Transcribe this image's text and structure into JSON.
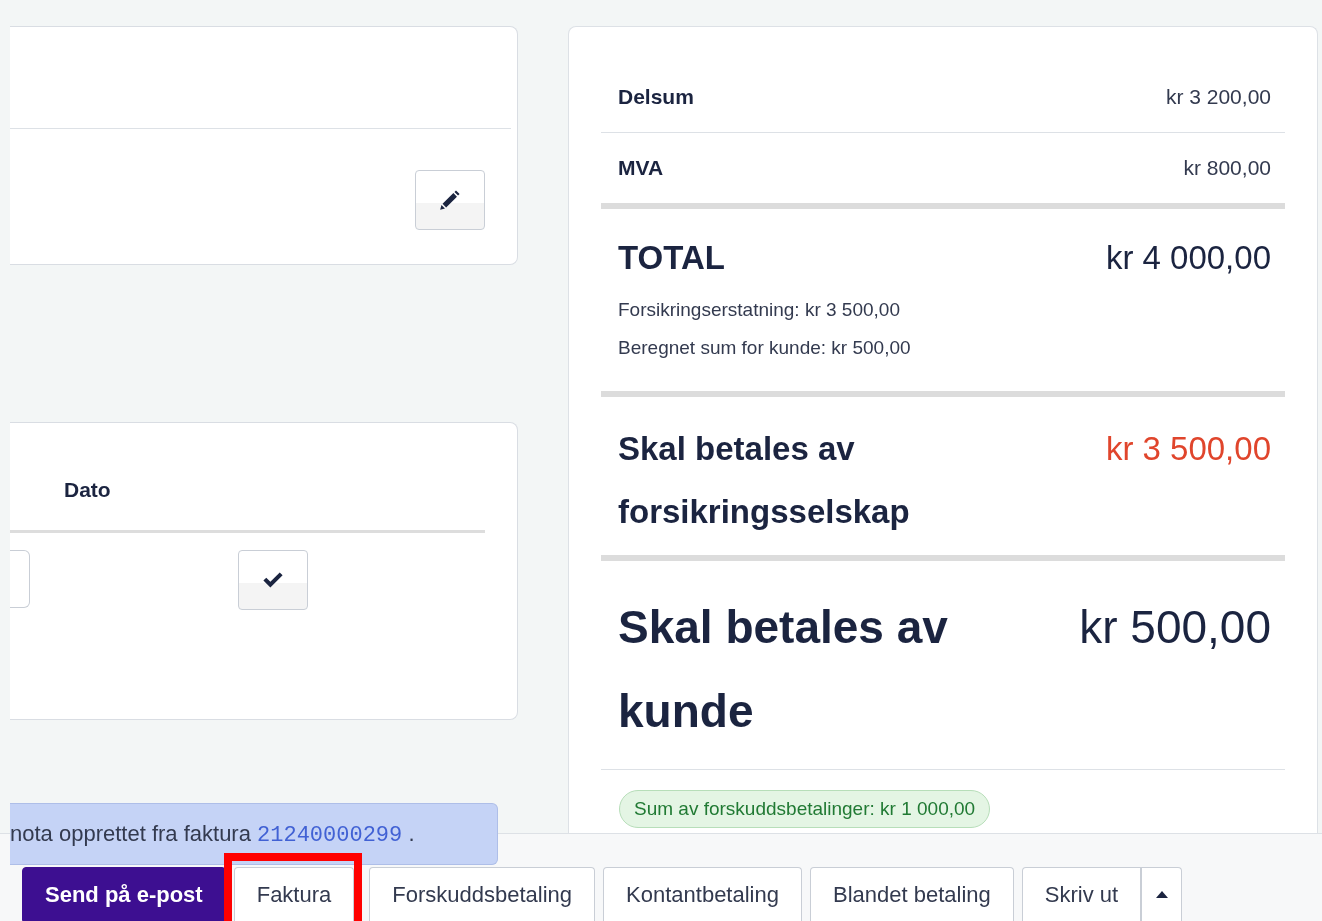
{
  "details_card": {
    "edit_button": {
      "kind": "edit"
    }
  },
  "dates_card": {
    "columns": [
      "Dato"
    ],
    "confirm_button": {
      "kind": "confirm"
    }
  },
  "summary": {
    "lines": [
      {
        "label": "Delsum",
        "amount": "kr 3 200,00"
      },
      {
        "label": "MVA",
        "amount": "kr 800,00"
      }
    ],
    "total": {
      "label": "TOTAL",
      "amount": "kr 4 000,00",
      "notes": [
        "Forsikringserstatning: kr 3 500,00",
        "Beregnet sum for kunde: kr 500,00"
      ]
    },
    "dues": [
      {
        "kind": "insurer",
        "label": "Skal betales av forsikringsselskap",
        "amount": "kr 3 500,00"
      },
      {
        "kind": "customer",
        "label": "Skal betales av kunde",
        "amount": "kr 500,00"
      }
    ],
    "advance_badge": "Sum av forskuddsbetalinger: kr 1 000,00"
  },
  "alert": {
    "text": "nota opprettet fra faktura",
    "link": "21240000299",
    "suffix": "."
  },
  "actions": [
    {
      "label": "Send på e-post",
      "kind": "primary",
      "highlighted": false
    },
    {
      "label": "Faktura",
      "kind": "outline",
      "highlighted": true
    },
    {
      "label": "Forskuddsbetaling",
      "kind": "outline",
      "highlighted": false
    },
    {
      "label": "Kontantbetaling",
      "kind": "outline",
      "highlighted": false
    },
    {
      "label": "Blandet betaling",
      "kind": "outline",
      "highlighted": false
    },
    {
      "label": "Skriv ut",
      "kind": "split",
      "highlighted": false
    }
  ]
}
